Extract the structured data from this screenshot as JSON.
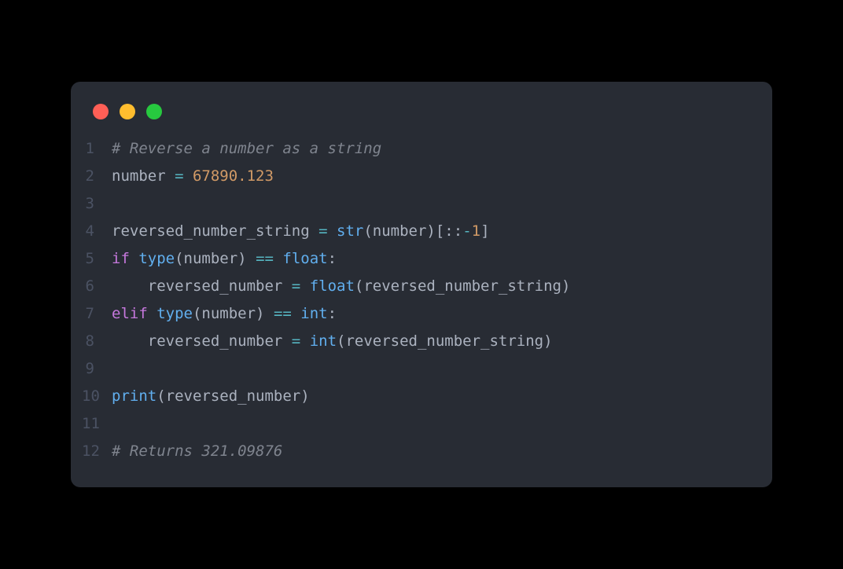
{
  "window": {
    "traffic_lights": [
      "close",
      "minimize",
      "zoom"
    ]
  },
  "colors": {
    "background": "#282c34",
    "page_bg": "#000000",
    "lineno": "#4b5263",
    "default": "#abb2bf",
    "comment": "#7f848e",
    "number": "#d19a66",
    "keyword": "#c678dd",
    "builtin": "#61afef",
    "compare": "#56b6c2",
    "red": "#ff5f56",
    "yellow": "#ffbd2e",
    "green": "#27c93f"
  },
  "code": {
    "language": "python",
    "lines": [
      {
        "n": "1",
        "tokens": [
          {
            "cls": "tok-comment",
            "t": "# Reverse a number as a string"
          }
        ]
      },
      {
        "n": "2",
        "tokens": [
          {
            "cls": "tok-ident",
            "t": "number "
          },
          {
            "cls": "tok-cmp",
            "t": "="
          },
          {
            "cls": "tok-ident",
            "t": " "
          },
          {
            "cls": "tok-number",
            "t": "67890.123"
          }
        ]
      },
      {
        "n": "3",
        "tokens": []
      },
      {
        "n": "4",
        "tokens": [
          {
            "cls": "tok-ident",
            "t": "reversed_number_string "
          },
          {
            "cls": "tok-cmp",
            "t": "="
          },
          {
            "cls": "tok-ident",
            "t": " "
          },
          {
            "cls": "tok-builtin",
            "t": "str"
          },
          {
            "cls": "tok-punct",
            "t": "(number)[::"
          },
          {
            "cls": "tok-cmp",
            "t": "-"
          },
          {
            "cls": "tok-number",
            "t": "1"
          },
          {
            "cls": "tok-punct",
            "t": "]"
          }
        ]
      },
      {
        "n": "5",
        "tokens": [
          {
            "cls": "tok-kw",
            "t": "if"
          },
          {
            "cls": "tok-ident",
            "t": " "
          },
          {
            "cls": "tok-builtin",
            "t": "type"
          },
          {
            "cls": "tok-punct",
            "t": "(number) "
          },
          {
            "cls": "tok-cmp",
            "t": "=="
          },
          {
            "cls": "tok-ident",
            "t": " "
          },
          {
            "cls": "tok-builtin",
            "t": "float"
          },
          {
            "cls": "tok-punct",
            "t": ":"
          }
        ]
      },
      {
        "n": "6",
        "tokens": [
          {
            "cls": "tok-ident",
            "t": "    reversed_number "
          },
          {
            "cls": "tok-cmp",
            "t": "="
          },
          {
            "cls": "tok-ident",
            "t": " "
          },
          {
            "cls": "tok-builtin",
            "t": "float"
          },
          {
            "cls": "tok-punct",
            "t": "(reversed_number_string)"
          }
        ]
      },
      {
        "n": "7",
        "tokens": [
          {
            "cls": "tok-kw",
            "t": "elif"
          },
          {
            "cls": "tok-ident",
            "t": " "
          },
          {
            "cls": "tok-builtin",
            "t": "type"
          },
          {
            "cls": "tok-punct",
            "t": "(number) "
          },
          {
            "cls": "tok-cmp",
            "t": "=="
          },
          {
            "cls": "tok-ident",
            "t": " "
          },
          {
            "cls": "tok-builtin",
            "t": "int"
          },
          {
            "cls": "tok-punct",
            "t": ":"
          }
        ]
      },
      {
        "n": "8",
        "tokens": [
          {
            "cls": "tok-ident",
            "t": "    reversed_number "
          },
          {
            "cls": "tok-cmp",
            "t": "="
          },
          {
            "cls": "tok-ident",
            "t": " "
          },
          {
            "cls": "tok-builtin",
            "t": "int"
          },
          {
            "cls": "tok-punct",
            "t": "(reversed_number_string)"
          }
        ]
      },
      {
        "n": "9",
        "tokens": []
      },
      {
        "n": "10",
        "tokens": [
          {
            "cls": "tok-builtin",
            "t": "print"
          },
          {
            "cls": "tok-punct",
            "t": "(reversed_number)"
          }
        ]
      },
      {
        "n": "11",
        "tokens": []
      },
      {
        "n": "12",
        "tokens": [
          {
            "cls": "tok-comment",
            "t": "# Returns 321.09876"
          }
        ]
      }
    ]
  }
}
